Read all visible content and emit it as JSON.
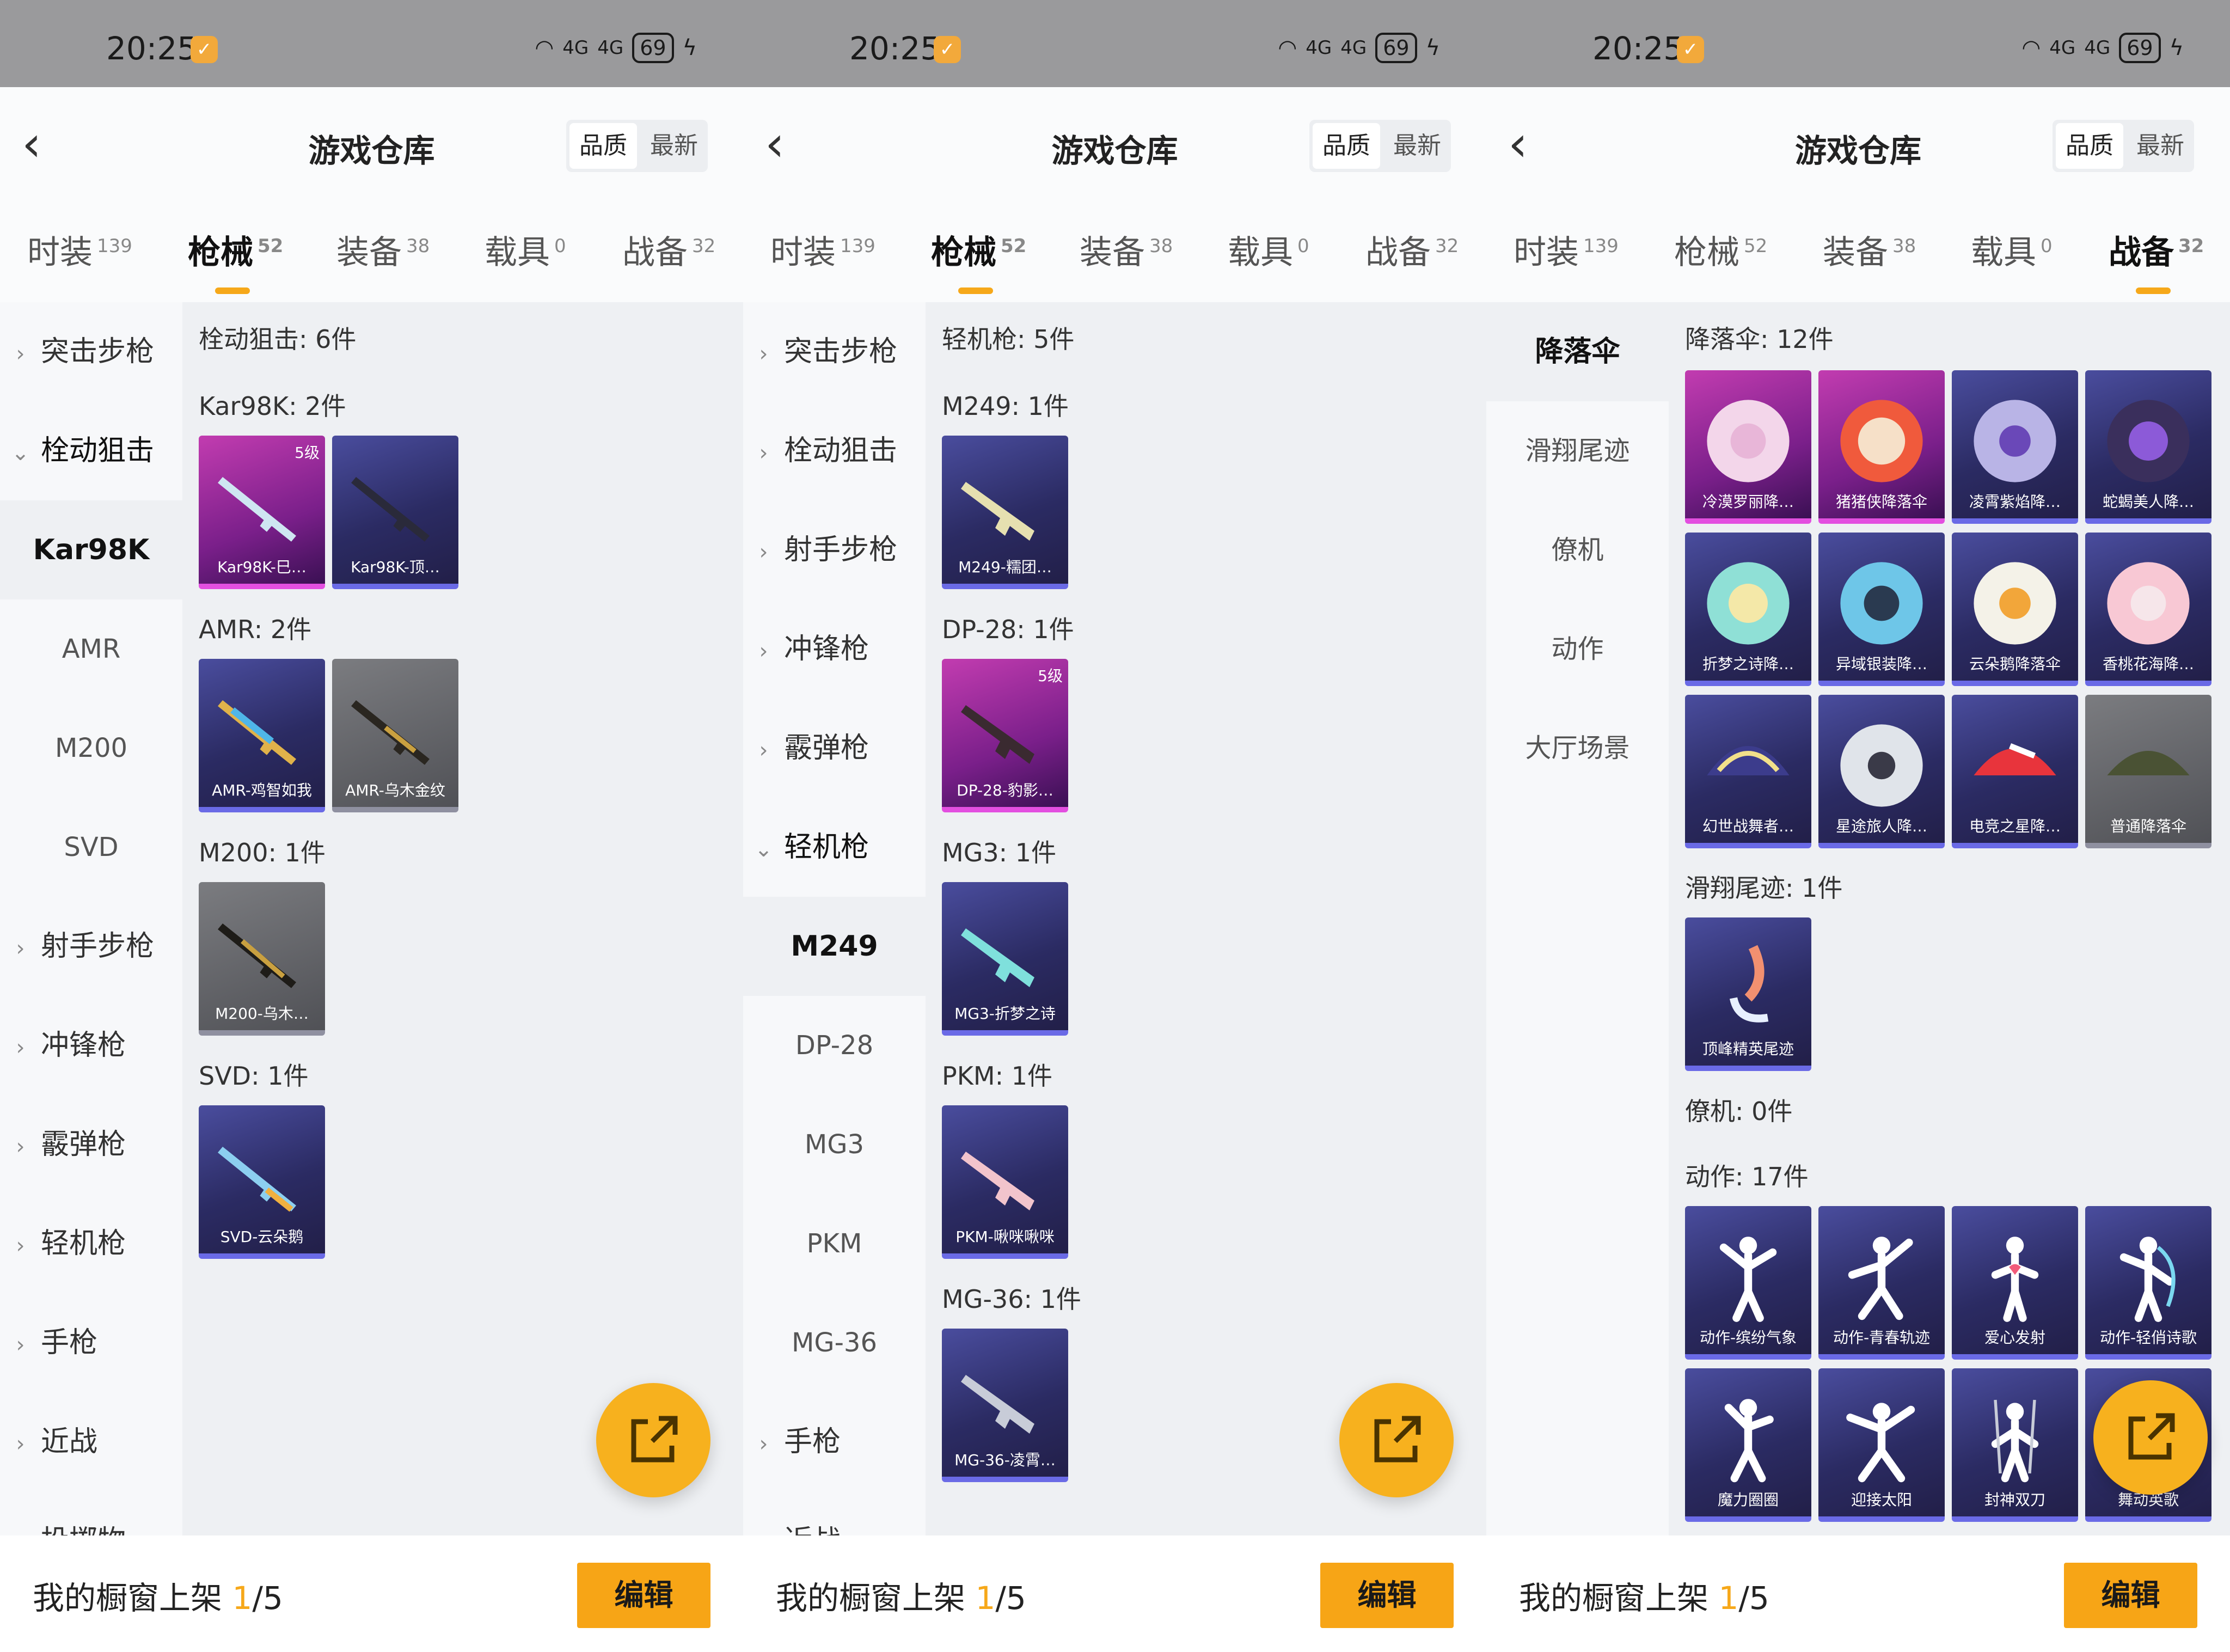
{
  "status": {
    "time": "20:25",
    "battery": "69",
    "signal": "4G"
  },
  "header": {
    "title": "游戏仓库",
    "sort_quality": "品质",
    "sort_newest": "最新"
  },
  "tabs": [
    {
      "label": "时装",
      "count": "139"
    },
    {
      "label": "枪械",
      "count": "52"
    },
    {
      "label": "装备",
      "count": "38"
    },
    {
      "label": "载具",
      "count": "0"
    },
    {
      "label": "战备",
      "count": "32"
    }
  ],
  "bottom": {
    "prefix": "我的橱窗上架 ",
    "count": "1",
    "total": "/5",
    "edit": "编辑"
  },
  "panel1": {
    "nav": [
      "突击步枪",
      "栓动狙击",
      "Kar98K",
      "AMR",
      "M200",
      "SVD",
      "射手步枪",
      "冲锋枪",
      "霰弹枪",
      "轻机枪",
      "手枪",
      "近战",
      "投掷物"
    ],
    "heading": "栓动狙击: 6件",
    "sections": [
      {
        "title": "Kar98K: 2件",
        "items": [
          {
            "label": "Kar98K-巳…",
            "level": "5级",
            "rarity": "purple"
          },
          {
            "label": "Kar98K-顶…",
            "rarity": "blue"
          }
        ]
      },
      {
        "title": "AMR: 2件",
        "items": [
          {
            "label": "AMR-鸡智如我",
            "rarity": "blue"
          },
          {
            "label": "AMR-乌木金纹",
            "rarity": "gray"
          }
        ]
      },
      {
        "title": "M200: 1件",
        "items": [
          {
            "label": "M200-乌木…",
            "rarity": "gray"
          }
        ]
      },
      {
        "title": "SVD: 1件",
        "items": [
          {
            "label": "SVD-云朵鹅",
            "rarity": "blue"
          }
        ]
      }
    ]
  },
  "panel2": {
    "nav": [
      "突击步枪",
      "栓动狙击",
      "射手步枪",
      "冲锋枪",
      "霰弹枪",
      "轻机枪",
      "M249",
      "DP-28",
      "MG3",
      "PKM",
      "MG-36",
      "手枪",
      "近战"
    ],
    "heading": "轻机枪: 5件",
    "sections": [
      {
        "title": "M249: 1件",
        "items": [
          {
            "label": "M249-糯团…",
            "rarity": "blue"
          }
        ]
      },
      {
        "title": "DP-28: 1件",
        "items": [
          {
            "label": "DP-28-豹影…",
            "level": "5级",
            "rarity": "purple"
          }
        ]
      },
      {
        "title": "MG3: 1件",
        "items": [
          {
            "label": "MG3-折梦之诗",
            "rarity": "blue"
          }
        ]
      },
      {
        "title": "PKM: 1件",
        "items": [
          {
            "label": "PKM-啾咪啾咪",
            "rarity": "blue"
          }
        ]
      },
      {
        "title": "MG-36: 1件",
        "items": [
          {
            "label": "MG-36-凌霄…",
            "rarity": "blue"
          }
        ]
      }
    ]
  },
  "panel3": {
    "nav": [
      "降落伞",
      "滑翔尾迹",
      "僚机",
      "动作",
      "大厅场景"
    ],
    "sections": [
      {
        "title": "降落伞: 12件",
        "items": [
          {
            "label": "冷漠罗丽降…",
            "rarity": "purple"
          },
          {
            "label": "猪猪侠降落伞",
            "rarity": "purple"
          },
          {
            "label": "凌霄紫焰降…",
            "rarity": "blue"
          },
          {
            "label": "蛇蝎美人降…",
            "rarity": "blue"
          },
          {
            "label": "折梦之诗降…",
            "rarity": "blue"
          },
          {
            "label": "异域银装降…",
            "rarity": "blue"
          },
          {
            "label": "云朵鹅降落伞",
            "rarity": "blue"
          },
          {
            "label": "香桃花海降…",
            "rarity": "blue"
          },
          {
            "label": "幻世战舞者…",
            "rarity": "blue"
          },
          {
            "label": "星途旅人降…",
            "rarity": "blue"
          },
          {
            "label": "电竞之星降…",
            "rarity": "blue"
          },
          {
            "label": "普通降落伞",
            "rarity": "gray"
          }
        ]
      },
      {
        "title": "滑翔尾迹: 1件",
        "items": [
          {
            "label": "顶峰精英尾迹",
            "rarity": "blue"
          }
        ]
      },
      {
        "title": "僚机: 0件",
        "items": []
      },
      {
        "title": "动作: 17件",
        "items": [
          {
            "label": "动作-缤纷气象",
            "rarity": "blue"
          },
          {
            "label": "动作-青春轨迹",
            "rarity": "blue"
          },
          {
            "label": "爱心发射",
            "rarity": "blue"
          },
          {
            "label": "动作-轻俏诗歌",
            "rarity": "blue"
          },
          {
            "label": "魔力圈圈",
            "rarity": "blue"
          },
          {
            "label": "迎接太阳",
            "rarity": "blue"
          },
          {
            "label": "封神双刀",
            "rarity": "blue"
          },
          {
            "label": "舞动英歌",
            "rarity": "blue"
          }
        ]
      }
    ]
  }
}
